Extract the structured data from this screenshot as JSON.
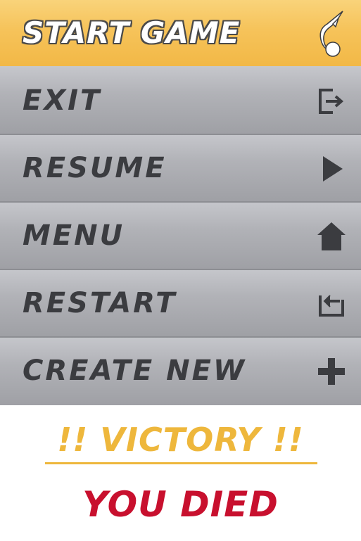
{
  "menu": {
    "start": {
      "label": "START GAME",
      "icon": "paint-splash-icon"
    },
    "exit": {
      "label": "EXIT",
      "icon": "exit-icon"
    },
    "resume": {
      "label": "RESUME",
      "icon": "play-icon"
    },
    "menu": {
      "label": "MENU",
      "icon": "home-icon"
    },
    "restart": {
      "label": "RESTART",
      "icon": "restart-icon"
    },
    "create_new": {
      "label": "CREATE NEW",
      "icon": "plus-icon"
    }
  },
  "messages": {
    "victory": "!! VICTORY !!",
    "died": "YOU DIED"
  },
  "colors": {
    "accent_yellow": "#f6c35a",
    "button_gray": "#b1b2b7",
    "label_dark": "#3b3c40",
    "victory": "#eeb73c",
    "died": "#c8102e"
  }
}
